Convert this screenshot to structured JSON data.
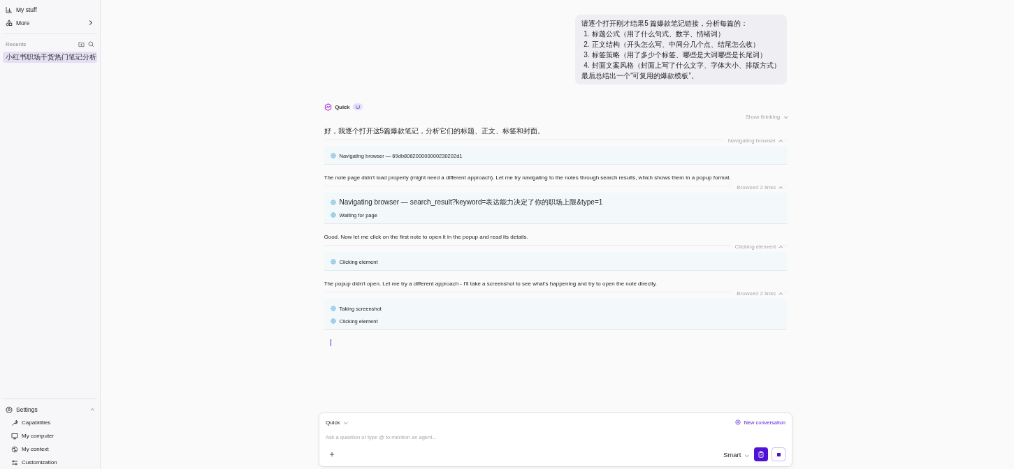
{
  "sidebar": {
    "top_items": [
      {
        "label": "My stuff"
      },
      {
        "label": "More"
      }
    ],
    "recents": {
      "title": "Recents",
      "items": [
        {
          "label": "小红书职场干货热门笔记分析",
          "selected": true
        }
      ]
    },
    "settings": {
      "label": "Settings",
      "expanded": true,
      "items": [
        {
          "label": "Capabilities"
        },
        {
          "label": "My computer"
        },
        {
          "label": "My context"
        },
        {
          "label": "Customization"
        }
      ]
    }
  },
  "conversation": {
    "user_message": {
      "intro": "请逐个打开刚才结果5 篇爆款笔记链接，分析每篇的：",
      "list": [
        {
          "number": "1.",
          "text": "标题公式（用了什么句式、数字、情绪词）"
        },
        {
          "number": "2.",
          "text": "正文结构（开头怎么写、中间分几个点、结尾怎么收）"
        },
        {
          "number": "3.",
          "text": "标签策略（用了多少个标签、哪些是大词哪些是长尾词）"
        },
        {
          "number": "4.",
          "text": "封面文案风格（封面上写了什么文字、字体大小、排版方式）"
        }
      ],
      "outro": "最后总结出一个“可复用的爆款模板”。"
    },
    "agent": {
      "name": "Quick",
      "show_thinking": {
        "label": "Show thinking",
        "expanded": false
      },
      "steps": [
        {
          "kind": "text",
          "text": "好，我逐个打开这5篇爆款笔记，分析它们的标题、正文、标签和封面。"
        },
        {
          "kind": "tools",
          "label": "Navigating browser",
          "expanded": true,
          "items": [
            "Navigating browser — 69db808200000000230202d1"
          ]
        },
        {
          "kind": "text",
          "text": "The note page didn't load properly (might need a different approach). Let me try navigating to the notes through search results, which shows them in a popup format."
        },
        {
          "kind": "tools",
          "label": "Browsed 2 links",
          "expanded": true,
          "items": [
            "Navigating browser — search_result?keyword=表达能力决定了你的职场上限&type=1",
            "Waiting for page"
          ]
        },
        {
          "kind": "text",
          "text": "Good. Now let me click on the first note to open it in the popup and read its details."
        },
        {
          "kind": "tools",
          "label": "Clicking element",
          "expanded": true,
          "items": [
            "Clicking element"
          ]
        },
        {
          "kind": "text",
          "text": "The popup didn't open. Let me try a different approach - I'll take a screenshot to see what's happening and try to open the note directly."
        },
        {
          "kind": "tools",
          "label": "Browsed 2 links",
          "expanded": true,
          "items": [
            "Taking screenshot",
            "Clicking element"
          ]
        }
      ]
    }
  },
  "composer": {
    "mode": "Quick",
    "new_conversation": "New conversation",
    "placeholder": "Ask a question or type @ to mention an agent...",
    "model": "Smart"
  }
}
